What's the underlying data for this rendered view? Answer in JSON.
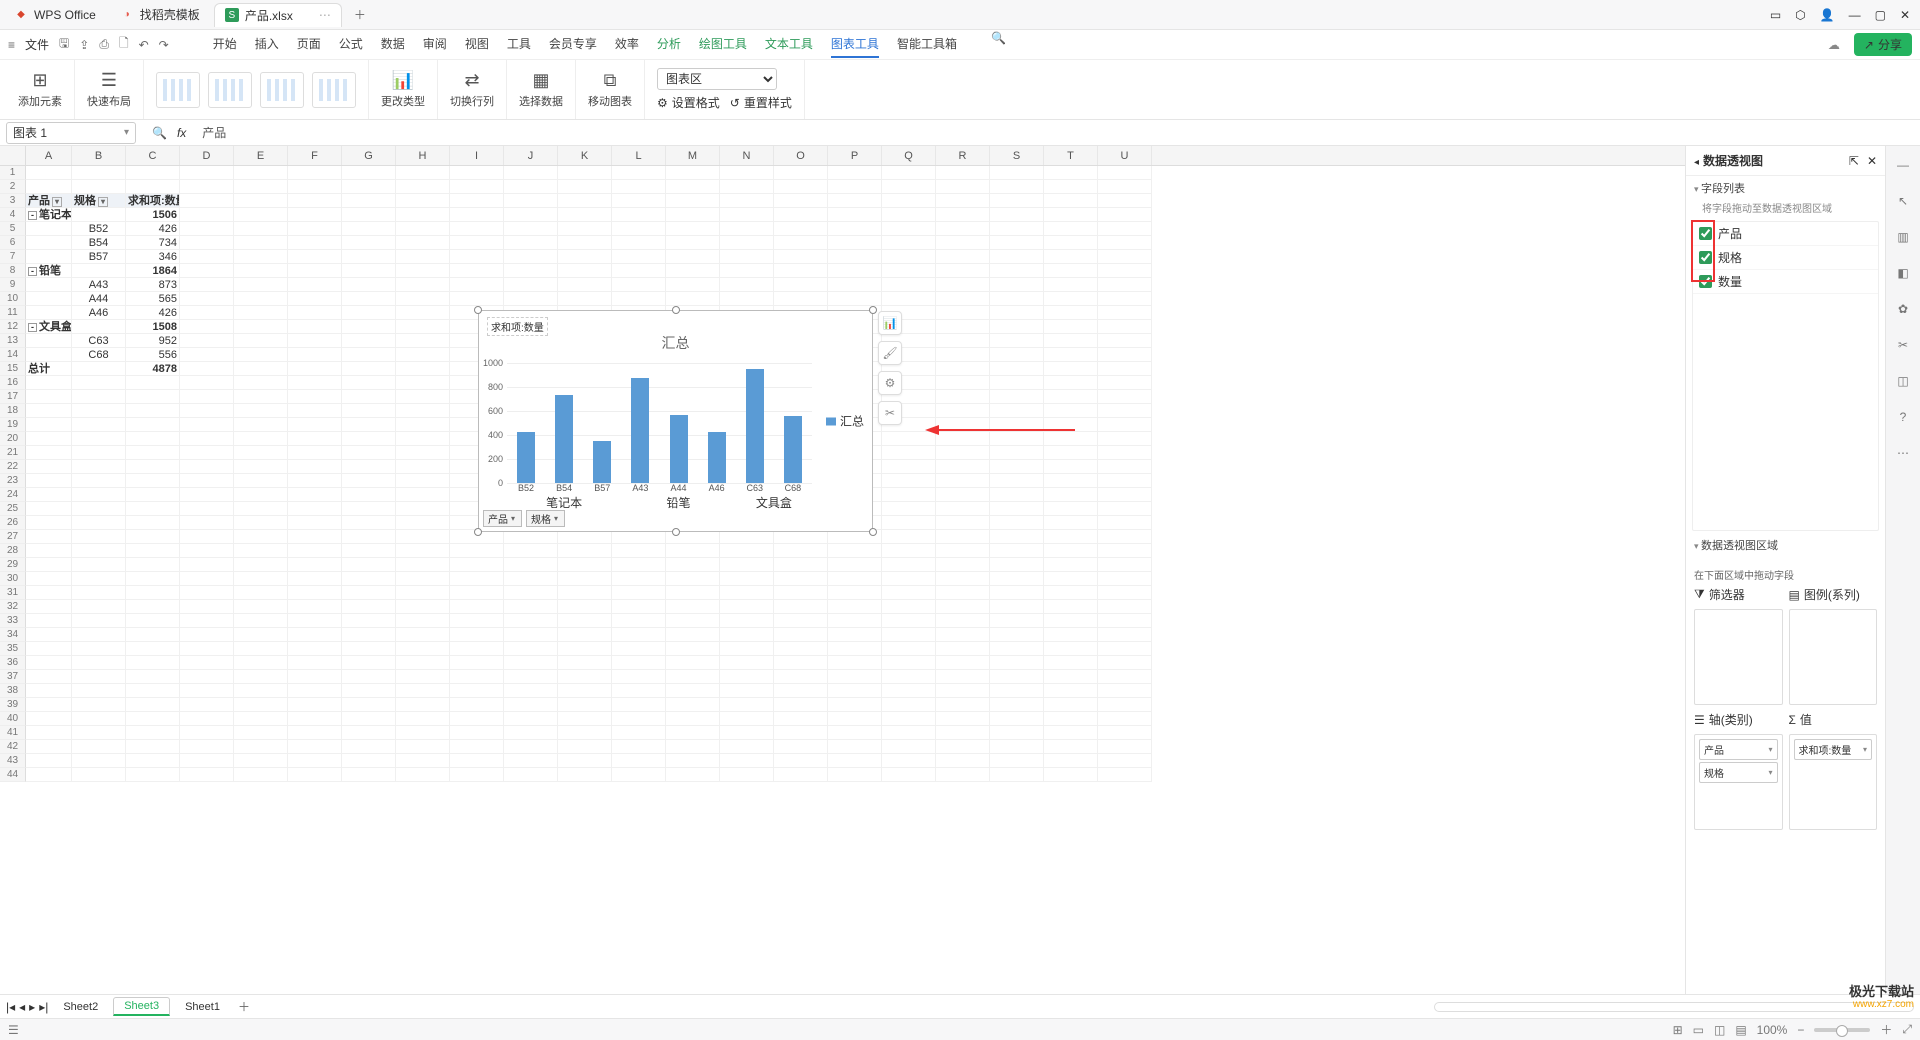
{
  "title_tabs": {
    "app": "WPS Office",
    "template": "找稻壳模板",
    "file": "产品.xlsx"
  },
  "window_buttons": {
    "min": "—",
    "max": "▢",
    "close": "✕"
  },
  "menu": {
    "file": "文件",
    "tabs": [
      "开始",
      "插入",
      "页面",
      "公式",
      "数据",
      "审阅",
      "视图",
      "工具",
      "会员专享",
      "效率",
      "分析",
      "绘图工具",
      "文本工具",
      "图表工具",
      "智能工具箱"
    ],
    "share": "分享"
  },
  "ribbon": {
    "add_element": "添加元素",
    "quick_layout": "快速布局",
    "change_type": "更改类型",
    "switch_rowcol": "切换行列",
    "select_data": "选择数据",
    "move_chart": "移动图表",
    "chart_area": "图表区",
    "set_format": "设置格式",
    "reset_style": "重置样式"
  },
  "namebox": "图表 1",
  "fx_value": "产品",
  "columns": [
    "A",
    "B",
    "C",
    "D",
    "E",
    "F",
    "G",
    "H",
    "I",
    "J",
    "K",
    "L",
    "M",
    "N",
    "O",
    "P",
    "Q",
    "R",
    "S",
    "T",
    "U"
  ],
  "pivot": {
    "h_product": "产品",
    "h_spec": "规格",
    "h_sum_qty": "求和项:数量",
    "rows": [
      {
        "a": "笔记本",
        "b": "",
        "c": "1506",
        "outline": true,
        "bold": true
      },
      {
        "a": "",
        "b": "B52",
        "c": "426"
      },
      {
        "a": "",
        "b": "B54",
        "c": "734"
      },
      {
        "a": "",
        "b": "B57",
        "c": "346"
      },
      {
        "a": "铅笔",
        "b": "",
        "c": "1864",
        "outline": true,
        "bold": true
      },
      {
        "a": "",
        "b": "A43",
        "c": "873"
      },
      {
        "a": "",
        "b": "A44",
        "c": "565"
      },
      {
        "a": "",
        "b": "A46",
        "c": "426"
      },
      {
        "a": "文具盒",
        "b": "",
        "c": "1508",
        "outline": true,
        "bold": true
      },
      {
        "a": "",
        "b": "C63",
        "c": "952"
      },
      {
        "a": "",
        "b": "C68",
        "c": "556"
      },
      {
        "a": "总计",
        "b": "",
        "c": "4878",
        "bold": true
      }
    ]
  },
  "chart_data": {
    "type": "bar",
    "title": "汇总",
    "value_field": "求和项:数量",
    "legend": "汇总",
    "categories": [
      "B52",
      "B54",
      "B57",
      "A43",
      "A44",
      "A46",
      "C63",
      "C68"
    ],
    "values": [
      426,
      734,
      346,
      873,
      565,
      426,
      952,
      556
    ],
    "groups": [
      {
        "label": "笔记本",
        "span": 3
      },
      {
        "label": "铅笔",
        "span": 3
      },
      {
        "label": "文具盒",
        "span": 2
      }
    ],
    "ylim": [
      0,
      1000
    ],
    "yticks": [
      0,
      200,
      400,
      600,
      800,
      1000
    ],
    "filters": [
      "产品",
      "规格"
    ]
  },
  "right_panel": {
    "title": "数据透视图",
    "field_list_title": "字段列表",
    "field_hint": "将字段拖动至数据透视图区域",
    "fields": [
      "产品",
      "规格",
      "数量"
    ],
    "areas_title": "数据透视图区域",
    "areas_hint": "在下面区域中拖动字段",
    "labels": {
      "filter": "筛选器",
      "legend": "图例(系列)",
      "axis": "轴(类别)",
      "value": "值"
    },
    "axis_chips": [
      "产品",
      "规格"
    ],
    "value_chips": [
      "求和项:数量"
    ]
  },
  "sheet_tabs": [
    "Sheet2",
    "Sheet3",
    "Sheet1"
  ],
  "active_sheet": "Sheet3",
  "status": {
    "zoom": "100%"
  },
  "watermark": {
    "name": "极光下载站",
    "url": "www.xz7.com"
  }
}
